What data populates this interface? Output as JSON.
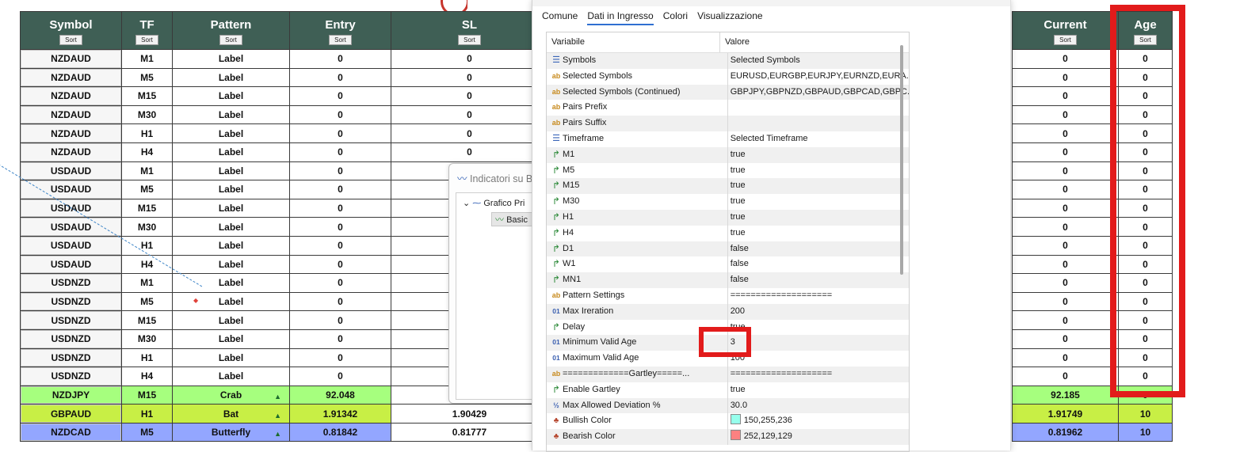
{
  "left_table": {
    "sort_label": "Sort",
    "columns": [
      "Symbol",
      "TF",
      "Pattern",
      "Entry",
      "SL"
    ],
    "rows": [
      {
        "symbol": "NZDAUD",
        "tf": "M1",
        "pattern": "Label",
        "entry": "0",
        "sl": "0",
        "style": "plain"
      },
      {
        "symbol": "NZDAUD",
        "tf": "M5",
        "pattern": "Label",
        "entry": "0",
        "sl": "0",
        "style": "plain"
      },
      {
        "symbol": "NZDAUD",
        "tf": "M15",
        "pattern": "Label",
        "entry": "0",
        "sl": "0",
        "style": "plain"
      },
      {
        "symbol": "NZDAUD",
        "tf": "M30",
        "pattern": "Label",
        "entry": "0",
        "sl": "0",
        "style": "plain"
      },
      {
        "symbol": "NZDAUD",
        "tf": "H1",
        "pattern": "Label",
        "entry": "0",
        "sl": "0",
        "style": "plain"
      },
      {
        "symbol": "NZDAUD",
        "tf": "H4",
        "pattern": "Label",
        "entry": "0",
        "sl": "0",
        "style": "plain"
      },
      {
        "symbol": "USDAUD",
        "tf": "M1",
        "pattern": "Label",
        "entry": "0",
        "sl": "",
        "style": "plain"
      },
      {
        "symbol": "USDAUD",
        "tf": "M5",
        "pattern": "Label",
        "entry": "0",
        "sl": "",
        "style": "plain"
      },
      {
        "symbol": "USDAUD",
        "tf": "M15",
        "pattern": "Label",
        "entry": "0",
        "sl": "",
        "style": "plain"
      },
      {
        "symbol": "USDAUD",
        "tf": "M30",
        "pattern": "Label",
        "entry": "0",
        "sl": "",
        "style": "plain"
      },
      {
        "symbol": "USDAUD",
        "tf": "H1",
        "pattern": "Label",
        "entry": "0",
        "sl": "",
        "style": "plain"
      },
      {
        "symbol": "USDAUD",
        "tf": "H4",
        "pattern": "Label",
        "entry": "0",
        "sl": "",
        "style": "plain"
      },
      {
        "symbol": "USDNZD",
        "tf": "M1",
        "pattern": "Label",
        "entry": "0",
        "sl": "",
        "style": "plain"
      },
      {
        "symbol": "USDNZD",
        "tf": "M5",
        "pattern": "Label",
        "entry": "0",
        "sl": "",
        "style": "plain"
      },
      {
        "symbol": "USDNZD",
        "tf": "M15",
        "pattern": "Label",
        "entry": "0",
        "sl": "",
        "style": "plain"
      },
      {
        "symbol": "USDNZD",
        "tf": "M30",
        "pattern": "Label",
        "entry": "0",
        "sl": "",
        "style": "plain"
      },
      {
        "symbol": "USDNZD",
        "tf": "H1",
        "pattern": "Label",
        "entry": "0",
        "sl": "",
        "style": "plain"
      },
      {
        "symbol": "USDNZD",
        "tf": "H4",
        "pattern": "Label",
        "entry": "0",
        "sl": "",
        "style": "plain"
      },
      {
        "symbol": "NZDJPY",
        "tf": "M15",
        "pattern": "Crab",
        "entry": "92.048",
        "sl": "",
        "style": "green"
      },
      {
        "symbol": "GBPAUD",
        "tf": "H1",
        "pattern": "Bat",
        "entry": "1.91342",
        "sl": "1.90429",
        "style": "lime"
      },
      {
        "symbol": "NZDCAD",
        "tf": "M5",
        "pattern": "Butterfly",
        "entry": "0.81842",
        "sl": "0.81777",
        "style": "blue"
      }
    ]
  },
  "right_table": {
    "sort_label": "Sort",
    "columns": [
      "Current",
      "Age"
    ],
    "rows": [
      {
        "current": "0",
        "age": "0",
        "style": "plain"
      },
      {
        "current": "0",
        "age": "0",
        "style": "plain"
      },
      {
        "current": "0",
        "age": "0",
        "style": "plain"
      },
      {
        "current": "0",
        "age": "0",
        "style": "plain"
      },
      {
        "current": "0",
        "age": "0",
        "style": "plain"
      },
      {
        "current": "0",
        "age": "0",
        "style": "plain"
      },
      {
        "current": "0",
        "age": "0",
        "style": "plain"
      },
      {
        "current": "0",
        "age": "0",
        "style": "plain"
      },
      {
        "current": "0",
        "age": "0",
        "style": "plain"
      },
      {
        "current": "0",
        "age": "0",
        "style": "plain"
      },
      {
        "current": "0",
        "age": "0",
        "style": "plain"
      },
      {
        "current": "0",
        "age": "0",
        "style": "plain"
      },
      {
        "current": "0",
        "age": "0",
        "style": "plain"
      },
      {
        "current": "0",
        "age": "0",
        "style": "plain"
      },
      {
        "current": "0",
        "age": "0",
        "style": "plain"
      },
      {
        "current": "0",
        "age": "0",
        "style": "plain"
      },
      {
        "current": "0",
        "age": "0",
        "style": "plain"
      },
      {
        "current": "0",
        "age": "0",
        "style": "plain"
      },
      {
        "current": "92.185",
        "age": "0",
        "style": "green"
      },
      {
        "current": "1.91749",
        "age": "10",
        "style": "lime"
      },
      {
        "current": "0.81962",
        "age": "10",
        "style": "blue"
      }
    ]
  },
  "indicators_dialog": {
    "title": "Indicatori su B",
    "tree_root": "Grafico Pri",
    "tree_child": "Basic"
  },
  "properties": {
    "tabs": [
      "Comune",
      "Dati in Ingresso",
      "Colori",
      "Visualizzazione"
    ],
    "active_tab": 1,
    "header_variable": "Variabile",
    "header_value": "Valore",
    "rows": [
      {
        "icon": "list",
        "name": "Symbols",
        "value": "Selected Symbols"
      },
      {
        "icon": "ab",
        "name": "Selected Symbols",
        "value": "EURUSD,EURGBP,EURJPY,EURNZD,EURA..."
      },
      {
        "icon": "ab",
        "name": "Selected Symbols (Continued)",
        "value": "GBPJPY,GBPNZD,GBPAUD,GBPCAD,GBPC..."
      },
      {
        "icon": "ab",
        "name": "Pairs Prefix",
        "value": ""
      },
      {
        "icon": "ab",
        "name": "Pairs Suffix",
        "value": ""
      },
      {
        "icon": "list",
        "name": "Timeframe",
        "value": "Selected Timeframe"
      },
      {
        "icon": "bool",
        "name": "M1",
        "value": "true"
      },
      {
        "icon": "bool",
        "name": "M5",
        "value": "true"
      },
      {
        "icon": "bool",
        "name": "M15",
        "value": "true"
      },
      {
        "icon": "bool",
        "name": "M30",
        "value": "true"
      },
      {
        "icon": "bool",
        "name": "H1",
        "value": "true"
      },
      {
        "icon": "bool",
        "name": "H4",
        "value": "true"
      },
      {
        "icon": "bool",
        "name": "D1",
        "value": "false"
      },
      {
        "icon": "bool",
        "name": "W1",
        "value": "false"
      },
      {
        "icon": "bool",
        "name": "MN1",
        "value": "false"
      },
      {
        "icon": "ab",
        "name": "Pattern Settings",
        "value": "===================="
      },
      {
        "icon": "int",
        "name": "Max Ireration",
        "value": "200"
      },
      {
        "icon": "bool",
        "name": "Delay",
        "value": "true"
      },
      {
        "icon": "int",
        "name": "Minimum Valid Age",
        "value": "3"
      },
      {
        "icon": "int",
        "name": "Maximum Valid Age",
        "value": "100"
      },
      {
        "icon": "ab",
        "name": "=============Gartley=====...",
        "value": "===================="
      },
      {
        "icon": "bool",
        "name": "Enable Gartley",
        "value": "true"
      },
      {
        "icon": "frac",
        "name": "Max Allowed Deviation %",
        "value": "30.0"
      },
      {
        "icon": "color",
        "name": "Bullish Color",
        "value": "150,255,236",
        "swatch": "#96ffec"
      },
      {
        "icon": "color",
        "name": "Bearish Color",
        "value": "252,129,129",
        "swatch": "#fc8181"
      }
    ]
  },
  "colors": {
    "header_bg": "#3f5f55",
    "highlight_red": "#e21b1b",
    "row_green": "#a6ff7e",
    "row_lime": "#c8ef45",
    "row_blue": "#93a6ff"
  }
}
